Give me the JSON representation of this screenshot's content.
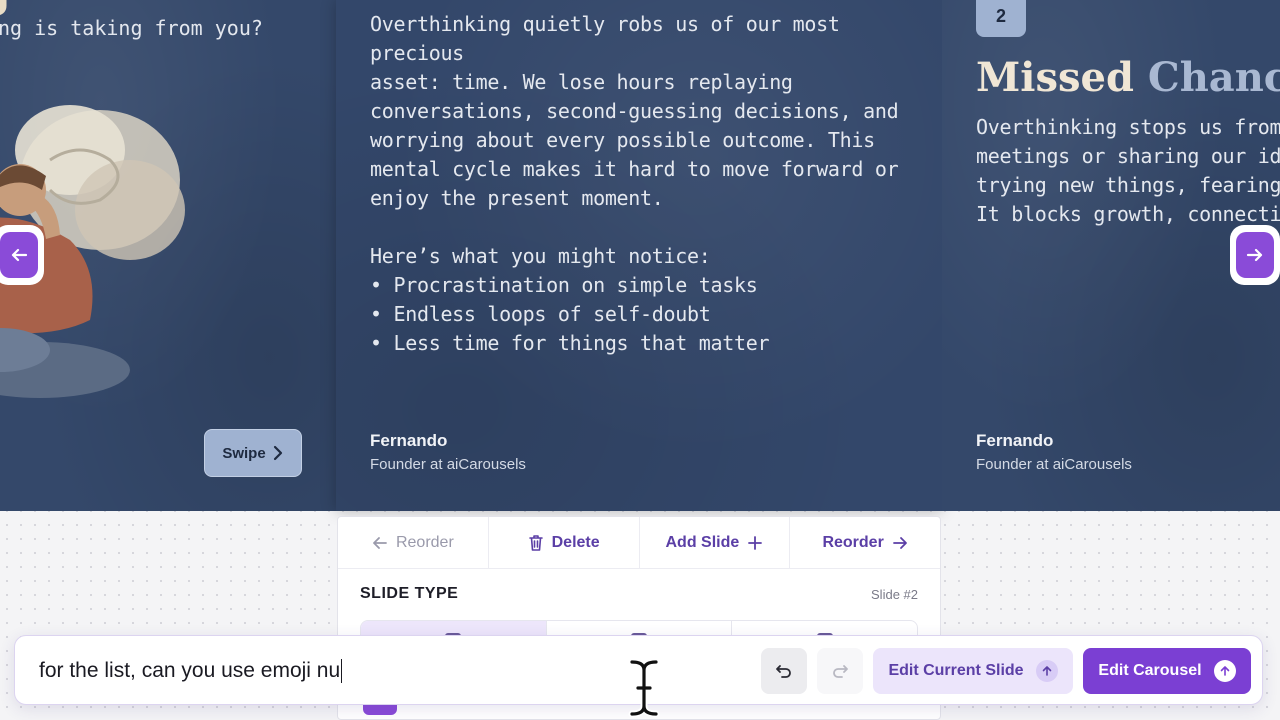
{
  "slides": {
    "left": {
      "title_fragment": "g",
      "subtitle": "ng is taking from you?",
      "swipe_label": "Swipe"
    },
    "center": {
      "paragraph_lines": [
        "Overthinking quietly robs us of our most precious",
        "asset: time. We lose hours replaying",
        "conversations, second-guessing decisions, and",
        "worrying about every possible outcome. This",
        "mental cycle makes it hard to move forward or",
        "enjoy the present moment."
      ],
      "list_intro": "Here’s what you might notice:",
      "bullets": [
        "• Procrastination on simple tasks",
        "• Endless loops of self-doubt",
        "• Less time for things that matter"
      ],
      "author_name": "Fernando",
      "author_role": "Founder at aiCarousels"
    },
    "right": {
      "number": "2",
      "title_main": "Missed ",
      "title_accent": "Chance",
      "body_lines": [
        "Overthinking stops us from s",
        "meetings or sharing our idea",
        "trying new things, fearing w",
        "It blocks growth, connectio"
      ],
      "author_name": "Fernando",
      "author_role": "Founder at aiCarousels"
    }
  },
  "toolbar": {
    "reorder_left_label": "Reorder",
    "delete_label": "Delete",
    "add_slide_label": "Add Slide",
    "reorder_right_label": "Reorder"
  },
  "panel": {
    "slide_type_label": "SLIDE TYPE",
    "slide_number": "Slide #2"
  },
  "chat": {
    "input_value": "for the list, can you use emoji nu",
    "edit_current_slide_label": "Edit Current Slide",
    "edit_carousel_label": "Edit Carousel"
  },
  "colors": {
    "slide_bg": "#34486a",
    "accent_purple": "#7b3fd3",
    "badge_blue": "#9fb2d1",
    "title_cream": "#f0e6d5"
  },
  "icons": [
    "arrow-left-icon",
    "arrow-right-icon",
    "chevron-right-icon",
    "trash-icon",
    "plus-icon",
    "undo-icon",
    "redo-icon",
    "arrow-up-icon",
    "text-cursor-icon"
  ]
}
